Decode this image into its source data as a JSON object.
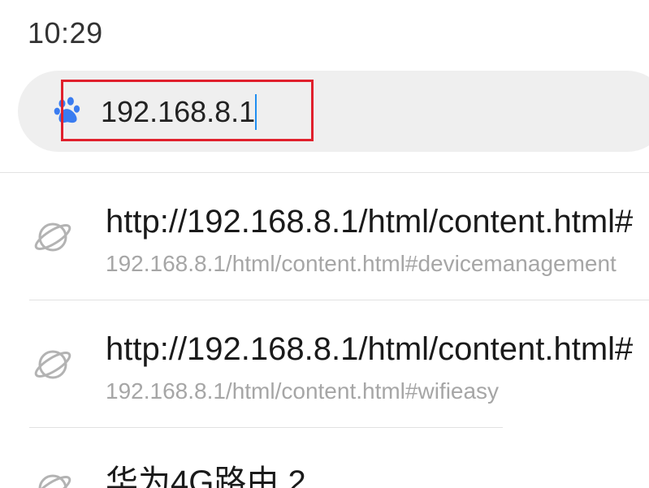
{
  "status_bar": {
    "time": "10:29"
  },
  "search": {
    "value": "192.168.8.1",
    "engine_icon": "baidu-paw-icon",
    "accent_color": "#3a7cf0",
    "highlight_color": "#e0202c"
  },
  "suggestions": [
    {
      "icon": "globe-icon",
      "title": "http://192.168.8.1/html/content.html#",
      "url": "192.168.8.1/html/content.html#devicemanagement"
    },
    {
      "icon": "globe-icon",
      "title": "http://192.168.8.1/html/content.html#",
      "url": "192.168.8.1/html/content.html#wifieasy"
    },
    {
      "icon": "globe-icon",
      "title": "华为4G路由 2",
      "url": ""
    }
  ]
}
